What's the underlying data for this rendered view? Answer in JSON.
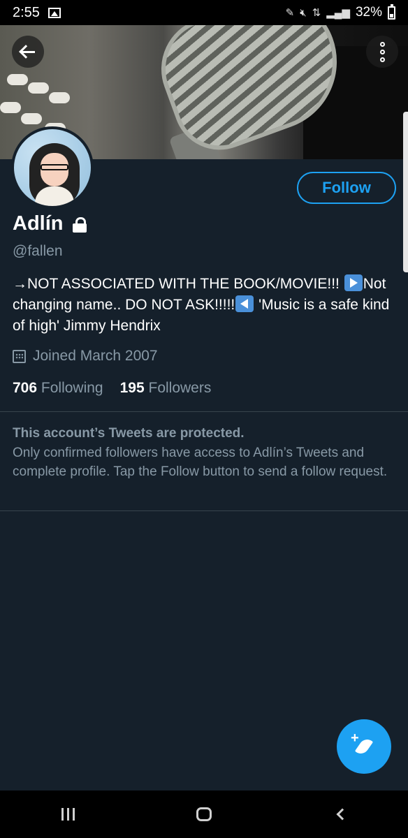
{
  "status_bar": {
    "time": "2:55",
    "battery": "32%",
    "icons": [
      "gallery-icon",
      "pen-icon",
      "mute-icon",
      "data-icon",
      "signal-icon",
      "battery-icon"
    ]
  },
  "profile": {
    "follow_label": "Follow",
    "display_name": "Adlín",
    "handle": "@fallen",
    "bio": {
      "part1": "→NOT ASSOCIATED WITH THE BOOK/MOVIE!!! ",
      "part2": "Not changing name.. DO NOT ASK!!!!!",
      "part3": "  'Music is a safe kind of high' Jimmy Hendrix"
    },
    "joined": "Joined March 2007",
    "following_count": "706",
    "following_label": "Following",
    "followers_count": "195",
    "followers_label": "Followers"
  },
  "protected_notice": {
    "title": "This account’s Tweets are protected.",
    "body": "Only confirmed followers have access to Adlín’s Tweets and complete profile. Tap the Follow button to send a follow request."
  },
  "colors": {
    "background": "#15202b",
    "accent": "#1da1f2",
    "secondary_text": "#8899a6"
  }
}
